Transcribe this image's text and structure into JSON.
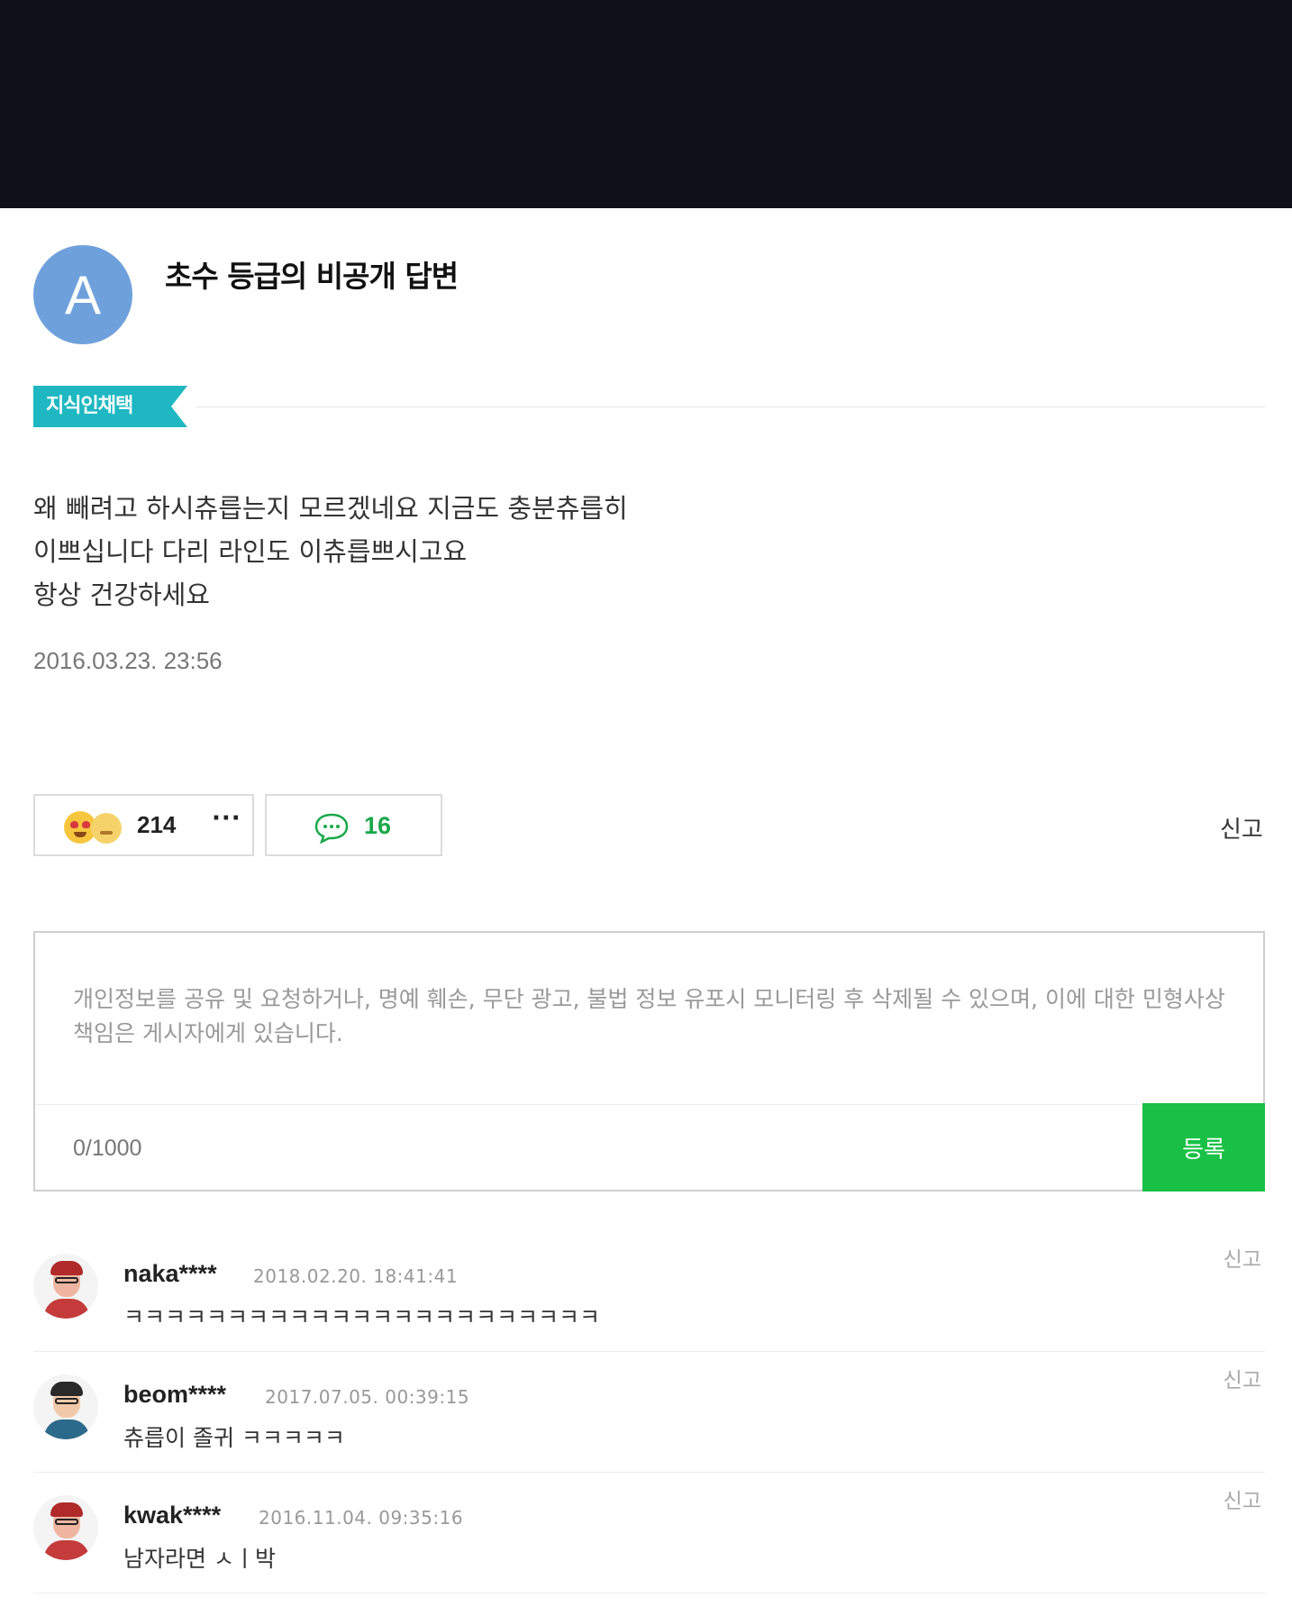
{
  "answer": {
    "avatar_letter": "A",
    "title": "초수 등급의 비공개 답변",
    "badge": "지식인채택",
    "body_lines": [
      "왜 빼려고 하시츄릅는지 모르겠네요 지금도 충분츄릅히",
      "이쁘십니다 다리 라인도 이츄릅쁘시고요",
      "항상 건강하세요"
    ],
    "date": "2016.03.23. 23:56"
  },
  "actions": {
    "reaction_count": "214",
    "more_label": "···",
    "comment_count": "16",
    "report_label": "신고"
  },
  "comment_form": {
    "placeholder": "개인정보를 공유 및 요청하거나, 명예 훼손, 무단 광고, 불법 정보 유포시 모니터링 후 삭제될 수 있으며, 이에 대한 민형사상 책임은 게시자에게 있습니다.",
    "char_count": "0/1000",
    "submit_label": "등록"
  },
  "comments": [
    {
      "name": "naka****",
      "date": "2018.02.20. 18:41:41",
      "text": "ㅋㅋㅋㅋㅋㅋㅋㅋㅋㅋㅋㅋㅋㅋㅋㅋㅋㅋㅋㅋㅋㅋㅋ",
      "report": "신고"
    },
    {
      "name": "beom****",
      "date": "2017.07.05. 00:39:15",
      "text": "츄릅이 졸귀 ㅋㅋㅋㅋㅋ",
      "report": "신고"
    },
    {
      "name": "kwak****",
      "date": "2016.11.04. 09:35:16",
      "text": "남자라면 ㅅㅣ박",
      "report": "신고"
    }
  ],
  "colors": {
    "top_bar": "#0e1117",
    "avatar": "#6ea1dc",
    "badge": "#1fb8c2",
    "submit": "#18c145",
    "comment_count": "#19a84a"
  }
}
